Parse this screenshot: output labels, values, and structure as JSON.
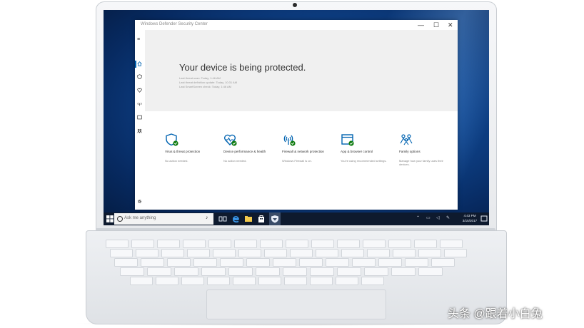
{
  "window": {
    "title": "Windows Defender Security Center",
    "controls": {
      "minimize": "—",
      "maximize": "☐",
      "close": "✕"
    }
  },
  "sidebar": {
    "menu_icon": "hamburger-icon",
    "items": [
      {
        "icon": "home-icon"
      },
      {
        "icon": "shield-icon"
      },
      {
        "icon": "heart-icon"
      },
      {
        "icon": "network-icon"
      },
      {
        "icon": "app-browser-icon"
      },
      {
        "icon": "family-icon"
      }
    ],
    "settings_icon": "gear-icon"
  },
  "hero": {
    "title": "Your device is being protected.",
    "lines": [
      "Last threat scan: Today, 1:46 AM",
      "Last threat definition update: Today, 10:31 AM",
      "Last SmartScreen check: Today, 1:46 AM"
    ]
  },
  "tiles": [
    {
      "label": "Virus & threat protection",
      "status": "No action needed.",
      "icon": "shield-icon"
    },
    {
      "label": "Device performance & health",
      "status": "No action needed.",
      "icon": "heart-pulse-icon"
    },
    {
      "label": "Firewall & network protection",
      "status": "Windows Firewall is on.",
      "icon": "wireless-antenna-icon"
    },
    {
      "label": "App & browser control",
      "status": "You're using recommended settings.",
      "icon": "browser-window-icon"
    },
    {
      "label": "Family options",
      "status": "Manage how your family uses their devices.",
      "icon": "family-icon"
    }
  ],
  "taskbar": {
    "search_placeholder": "Ask me anything",
    "clock_time": "4:43 PM",
    "clock_date": "3/15/2017"
  },
  "colors": {
    "accent": "#0063b1",
    "ok_green": "#107c10",
    "taskbar": "#0e1a2e"
  },
  "watermark": "头条 @跟着小白兔"
}
